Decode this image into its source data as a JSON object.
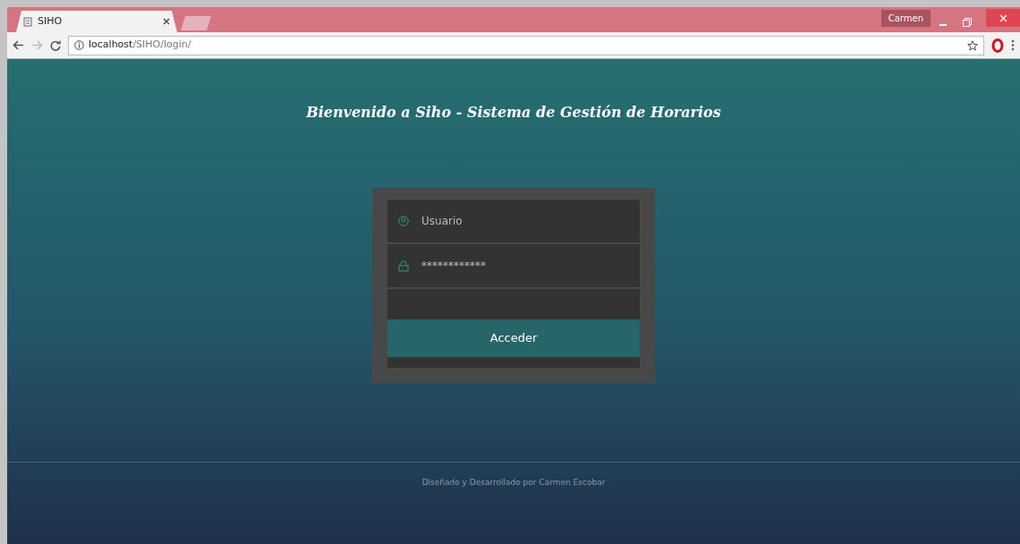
{
  "browser": {
    "tab_title": "SIHO",
    "profile": "Carmen",
    "url_host": "localhost",
    "url_path": "/SIHO/login/"
  },
  "page": {
    "heading": "Bienvenido a Siho - Sistema de Gestión de Horarios",
    "form": {
      "username": {
        "placeholder": "Usuario"
      },
      "password": {
        "placeholder": "************"
      },
      "submit": "Acceder"
    },
    "footer": "Diseñado y Desarrollado por Carmen Escobar"
  }
}
